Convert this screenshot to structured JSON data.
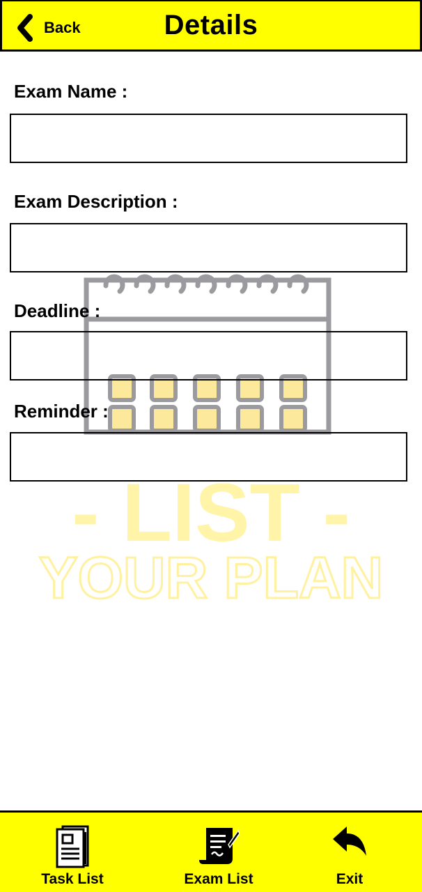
{
  "colors": {
    "accent": "#ffff00",
    "border": "#000000",
    "watermark_gray": "#9b9b9f",
    "watermark_yellow": "#fff4a8"
  },
  "header": {
    "back_label": "Back",
    "back_icon": "chevron-left-icon",
    "title": "Details"
  },
  "watermark": {
    "line1": "- LIST -",
    "line2": "YOUR PLAN",
    "icon": "calendar-icon"
  },
  "form": {
    "exam_name": {
      "label": "Exam Name :",
      "value": "",
      "placeholder": ""
    },
    "exam_description": {
      "label": "Exam Description :",
      "value": "",
      "placeholder": ""
    },
    "deadline": {
      "label": "Deadline :",
      "value": "",
      "placeholder": ""
    },
    "reminder": {
      "label": "Reminder :",
      "value": "",
      "placeholder": ""
    }
  },
  "bottom_nav": {
    "items": [
      {
        "label": "Task List",
        "icon": "task-list-icon"
      },
      {
        "label": "Exam List",
        "icon": "exam-list-icon"
      },
      {
        "label": "Exit",
        "icon": "exit-arrow-icon"
      }
    ]
  }
}
